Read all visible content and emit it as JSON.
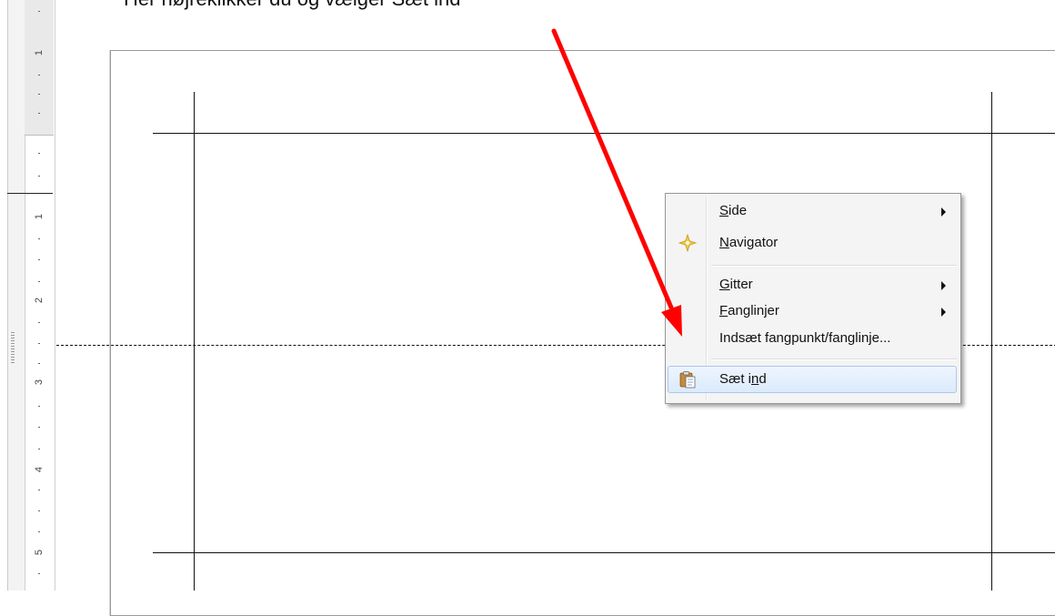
{
  "caption": "Her højreklikker du og vælger Sæt ind",
  "ruler": {
    "numbers": [
      "1",
      "1",
      "2",
      "3",
      "4",
      "5"
    ]
  },
  "menu": {
    "items": [
      {
        "prefix": "",
        "mnemonic": "S",
        "rest": "ide",
        "submenu": true
      },
      {
        "prefix": "",
        "mnemonic": "N",
        "rest": "avigator",
        "submenu": false,
        "icon": "navigator-star-icon"
      },
      {
        "prefix": "",
        "mnemonic": "G",
        "rest": "itter",
        "submenu": true
      },
      {
        "prefix": "",
        "mnemonic": "F",
        "rest": "anglinjer",
        "submenu": true
      },
      {
        "prefix": "",
        "mnemonic": "",
        "rest": "Indsæt fangpunkt/fanglinje...",
        "submenu": false
      },
      {
        "prefix": "Sæt i",
        "mnemonic": "n",
        "rest": "d",
        "submenu": false,
        "icon": "paste-clipboard-icon"
      }
    ]
  },
  "colors": {
    "annotation_arrow": "#ff0000",
    "menu_highlight": "#dbeafb",
    "navigator_icon": "#f2c94c"
  }
}
